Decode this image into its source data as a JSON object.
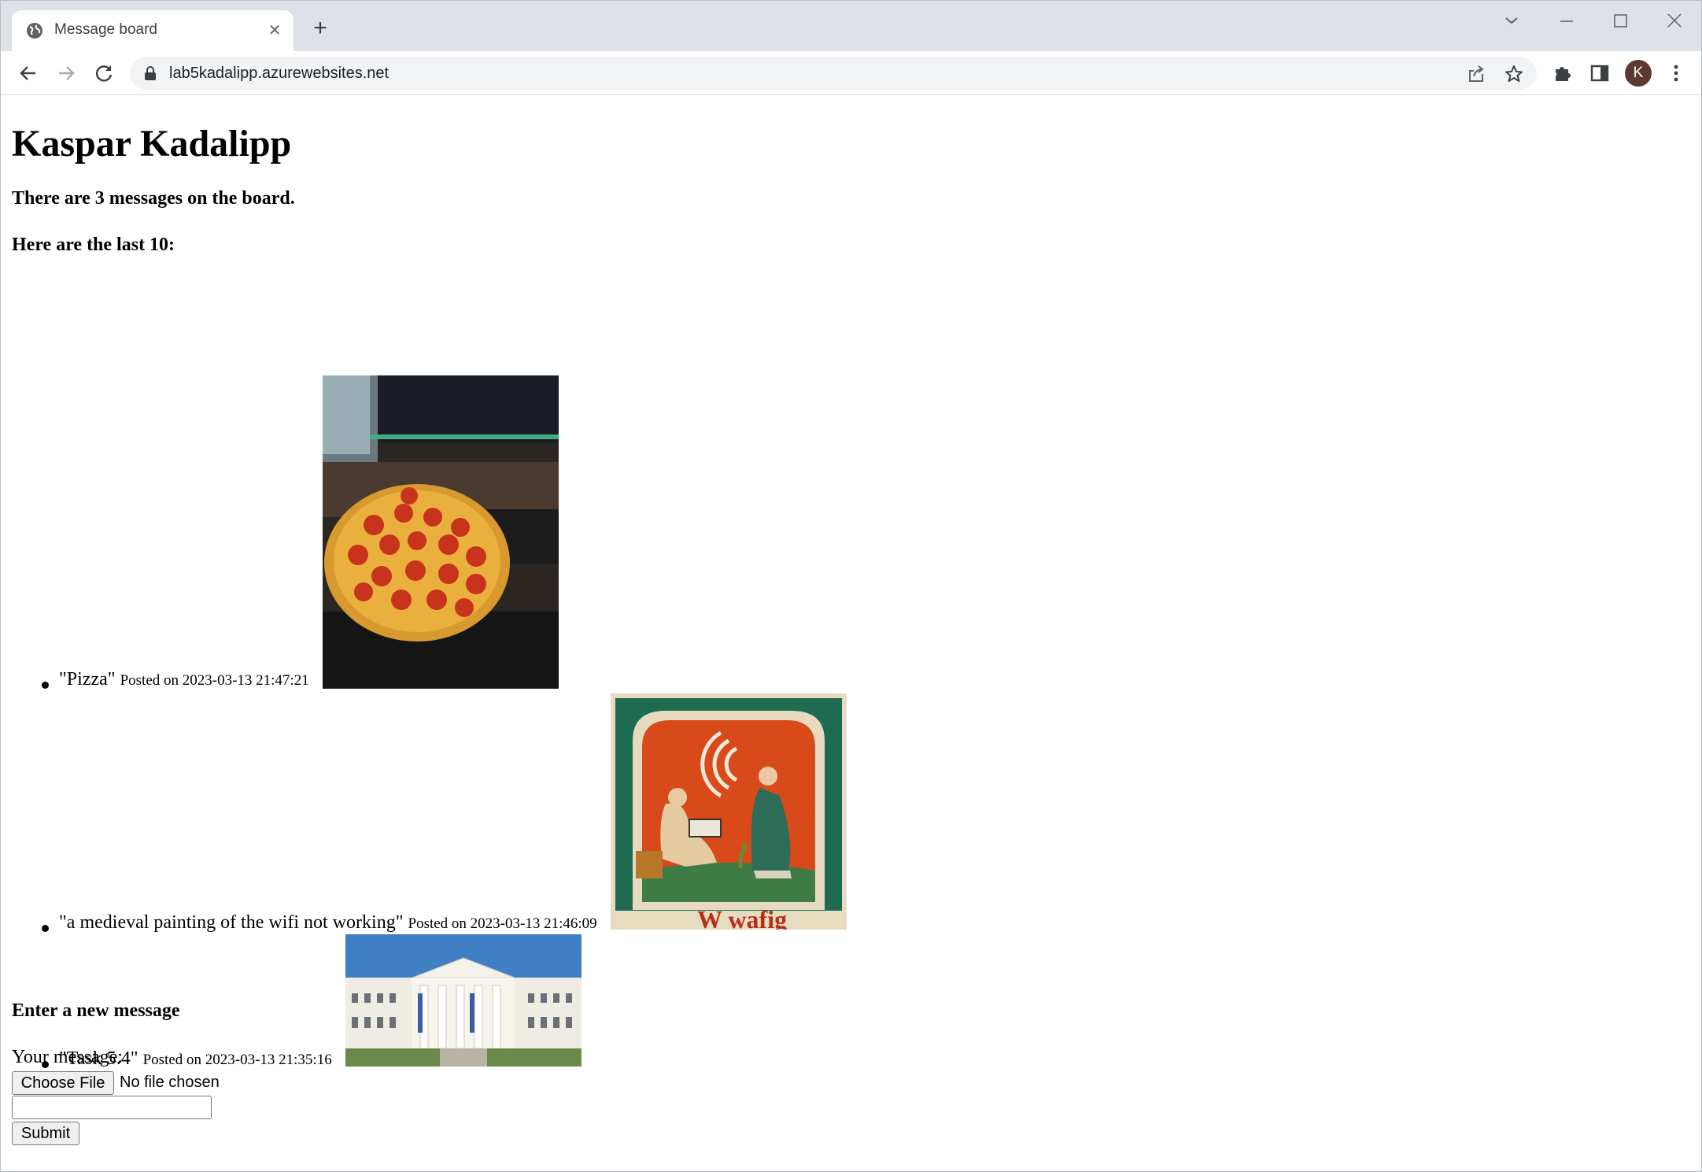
{
  "browser": {
    "tab_title": "Message board",
    "tab_close": "✕",
    "new_tab": "+",
    "url": "lab5kadalipp.azurewebsites.net",
    "profile_initial": "K"
  },
  "page": {
    "title": "Kaspar Kadalipp",
    "count_text": "There are 3 messages on the board.",
    "last_text": "Here are the last 10:",
    "messages": [
      {
        "text": "\"Pizza\"",
        "posted": "Posted on 2023-03-13 21:47:21",
        "image_desc": "pizza"
      },
      {
        "text": "\"a medieval painting of the wifi not working\"",
        "posted": "Posted on 2023-03-13 21:46:09",
        "image_desc": "medieval"
      },
      {
        "text": "\"Task 5.4\"",
        "posted": "Posted on 2023-03-13 21:35:16",
        "image_desc": "building"
      }
    ],
    "form": {
      "title": "Enter a new message",
      "label": "Your message:",
      "choose_file": "Choose File",
      "no_file": "No file chosen",
      "submit": "Submit"
    },
    "medieval_inscription": "W  wafig"
  }
}
